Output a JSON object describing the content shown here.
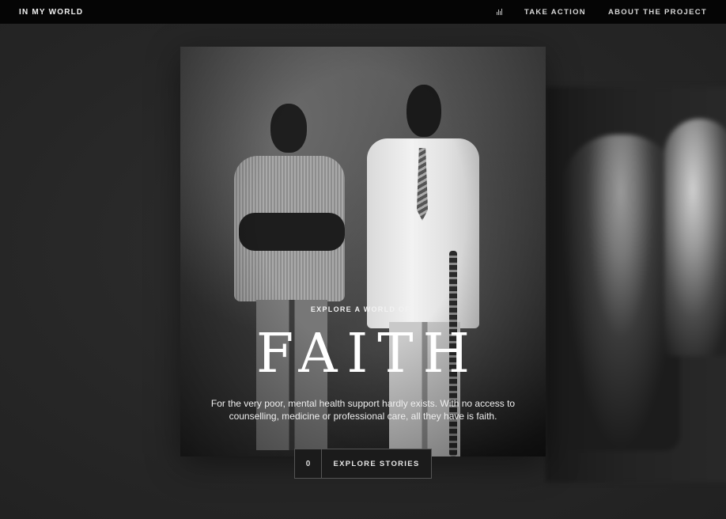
{
  "header": {
    "brand": "IN MY WORLD",
    "sound_icon": "sound-bars-icon",
    "nav": [
      "TAKE ACTION",
      "ABOUT THE PROJECT"
    ]
  },
  "feature": {
    "eyebrow": "EXPLORE A WORLD OF",
    "title": "FAITH",
    "description": "For the very poor, mental health support hardly exists. With no access to counselling, medicine or professional care, all they have is faith.",
    "cta_count": "0",
    "cta_label": "EXPLORE STORIES"
  },
  "colors": {
    "background": "#2a2a2a",
    "topbar": "#050505",
    "text": "#ffffff"
  }
}
